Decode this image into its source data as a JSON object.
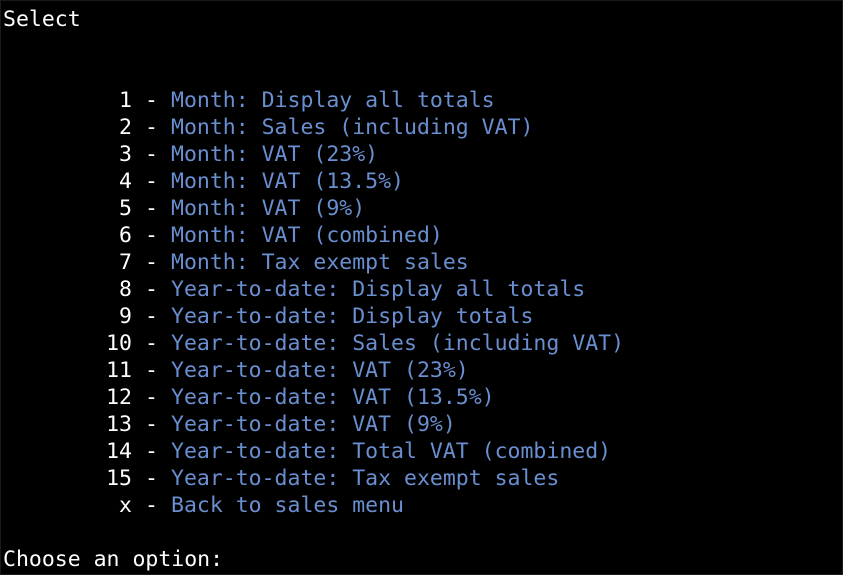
{
  "header": {
    "title": "Select"
  },
  "menu": {
    "separator": "-",
    "items": [
      {
        "key": "1",
        "label": "Month: Display all totals"
      },
      {
        "key": "2",
        "label": "Month: Sales (including VAT)"
      },
      {
        "key": "3",
        "label": "Month: VAT (23%)"
      },
      {
        "key": "4",
        "label": "Month: VAT (13.5%)"
      },
      {
        "key": "5",
        "label": "Month: VAT (9%)"
      },
      {
        "key": "6",
        "label": "Month: VAT (combined)"
      },
      {
        "key": "7",
        "label": "Month: Tax exempt sales"
      },
      {
        "key": "8",
        "label": "Year-to-date: Display all totals"
      },
      {
        "key": "9",
        "label": "Year-to-date: Display totals"
      },
      {
        "key": "10",
        "label": "Year-to-date: Sales (including VAT)"
      },
      {
        "key": "11",
        "label": "Year-to-date: VAT (23%)"
      },
      {
        "key": "12",
        "label": "Year-to-date: VAT (13.5%)"
      },
      {
        "key": "13",
        "label": "Year-to-date: VAT (9%)"
      },
      {
        "key": "14",
        "label": "Year-to-date: Total VAT (combined)"
      },
      {
        "key": "15",
        "label": "Year-to-date: Tax exempt sales"
      },
      {
        "key": "x",
        "label": "Back to sales menu"
      }
    ]
  },
  "prompt": {
    "text": "Choose an option:"
  },
  "colors": {
    "background": "#000000",
    "foreground": "#ffffff",
    "menu_label": "#6a8fd0"
  }
}
